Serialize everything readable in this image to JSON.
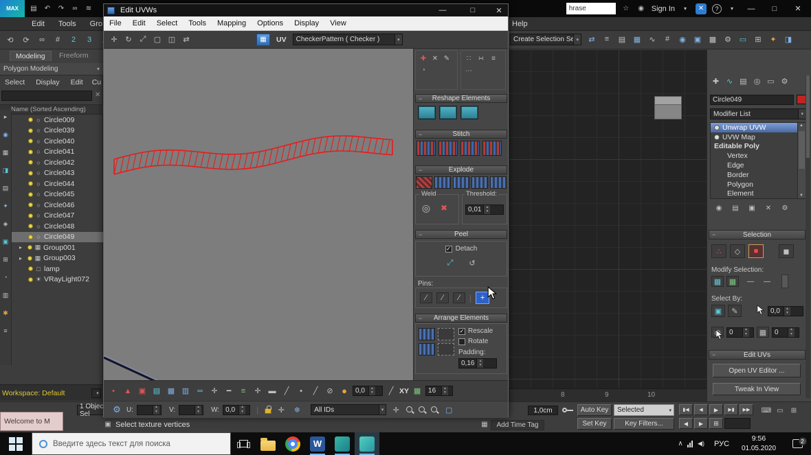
{
  "icons": {
    "check": "✓",
    "dropdown": "▾",
    "up": "▲",
    "down": "▼"
  },
  "titlebar": {
    "logo": "MAX",
    "search_value": "hrase",
    "signin": "Sign In",
    "min": "—",
    "max": "□",
    "close": "✕",
    "question": "?",
    "star": "☆",
    "user_icon": "◉",
    "x_icon": "✕",
    "dd": "▾"
  },
  "quick_icons": [
    "▤",
    "↶",
    "↷",
    "∞",
    "≋"
  ],
  "menubar": {
    "items": [
      "Edit",
      "Tools",
      "Gro"
    ],
    "help": "Help"
  },
  "toolbar": {
    "left_icons": [
      "⟲",
      "⟳",
      "∞",
      "#",
      "2",
      "3",
      "∠",
      "%"
    ],
    "create_selection": "Create Selection Se",
    "right_icons": [
      "⇄",
      "≡",
      "▤",
      "▦",
      "∿",
      "#",
      "◉",
      "▣",
      "▩",
      "⚙",
      "▭",
      "⊞",
      "✦",
      "◨"
    ]
  },
  "ribbon": {
    "tabs": [
      "Modeling",
      "Freeform"
    ],
    "subtitle": "Polygon Modeling",
    "dd": "▾"
  },
  "explorer": {
    "menus": [
      "Select",
      "Display",
      "Edit",
      "Cu"
    ],
    "clear": "✕",
    "header": "Name (Sorted Ascending)",
    "expander": "▸",
    "items": [
      {
        "label": "Circle009",
        "icon": "○"
      },
      {
        "label": "Circle039",
        "icon": "○"
      },
      {
        "label": "Circle040",
        "icon": "○"
      },
      {
        "label": "Circle041",
        "icon": "○"
      },
      {
        "label": "Circle042",
        "icon": "○"
      },
      {
        "label": "Circle043",
        "icon": "○"
      },
      {
        "label": "Circle044",
        "icon": "○"
      },
      {
        "label": "Circle045",
        "icon": "○"
      },
      {
        "label": "Circle046",
        "icon": "○"
      },
      {
        "label": "Circle047",
        "icon": "○"
      },
      {
        "label": "Circle048",
        "icon": "○"
      },
      {
        "label": "Circle049",
        "icon": "○"
      },
      {
        "label": "Group001",
        "icon": "▦"
      },
      {
        "label": "Group003",
        "icon": "▦"
      },
      {
        "label": "lamp",
        "icon": "□"
      },
      {
        "label": "VRayLight072",
        "icon": "☀"
      }
    ],
    "filter_icons": [
      "▸",
      "◉",
      "▦",
      "◨",
      "▤",
      "✦",
      "◈",
      "▣",
      "⊞",
      "◔",
      "▥",
      "✱",
      "≡"
    ],
    "workspace": "Workspace: Default"
  },
  "welcome": {
    "title": "Welcome to M"
  },
  "uvw": {
    "title": "Edit UVWs",
    "menus": [
      "File",
      "Edit",
      "Select",
      "Tools",
      "Mapping",
      "Options",
      "Display",
      "View"
    ],
    "toolbar_icons": [
      "✛",
      "↻",
      "⤢",
      "▢",
      "◫",
      "⇄"
    ],
    "uv_label": "UV",
    "pattern": "CheckerPattern  ( Checker )",
    "panel": {
      "top_icons_a": [
        "✚",
        "✕",
        "✎",
        "◔"
      ],
      "top_icons_b": [
        "∷",
        "∺",
        "≡",
        "⋯"
      ],
      "reshape": "Reshape Elements",
      "stitch": "Stitch",
      "explode": "Explode",
      "weld": "Weld",
      "weld_icons": [
        "◎",
        "✖"
      ],
      "threshold_label": "Threshold:",
      "threshold_value": "0,01",
      "peel": "Peel",
      "detach": "Detach",
      "peel_icons": [
        "⤢",
        "↺"
      ],
      "pins_label": "Pins:",
      "pin_icons": [
        "∕",
        "∕",
        "∕",
        "+"
      ],
      "arrange": "Arrange Elements",
      "rescale": "Rescale",
      "rotate": "Rotate",
      "padding_label": "Padding:",
      "padding_value": "0,16"
    },
    "bottom_icons": [
      "•",
      "▲",
      "▣",
      "▤",
      "▦",
      "▥",
      "═",
      "✛",
      "━",
      "≡",
      "✛",
      "▬",
      "╱",
      "•",
      "╱",
      "⊘",
      "●"
    ],
    "bottom": {
      "coord": "0,0",
      "slash": "╱",
      "axis": "XY",
      "grid_icon": "▦",
      "grid_value": "16",
      "u": "U:",
      "v": "V:",
      "w": "W:",
      "u_value": "",
      "v_value": "",
      "w_value": "0,0",
      "divider": "|",
      "hand": "✛",
      "snow": "❄",
      "ids": "All IDs",
      "gear": "⚙"
    },
    "status_icon": "▣"
  },
  "viewport": {
    "timeline_ticks": [
      "8",
      "9",
      "10"
    ]
  },
  "cmd": {
    "tab_icons": [
      "✚",
      "∿",
      "▤",
      "◎",
      "▭",
      "⚙"
    ],
    "object_name": "Circle049",
    "modifier_list": "Modifier List",
    "stack": [
      "Unwrap UVW",
      "UVW Map",
      "Editable Poly",
      "Vertex",
      "Edge",
      "Border",
      "Polygon",
      "Element"
    ],
    "stack_icons": [
      "◉",
      "▤",
      "▣",
      "✕",
      "⚙"
    ],
    "selection": "Selection",
    "sel_icons": [
      "∴",
      "◇",
      "■",
      "◼"
    ],
    "modify_selection": "Modify Selection:",
    "mod_icons": [
      "▦",
      "▦"
    ],
    "dash": "—",
    "select_by": "Select By:",
    "sb_icon1": "▣",
    "sb_icon2": "✎",
    "sb_icon3": "◉",
    "sb_icon4": "▦",
    "v1": "0,0",
    "v2": "0",
    "v3": "0",
    "edit_uvs": "Edit UVs",
    "open_btn": "Open UV Editor ...",
    "tweak_btn": "Tweak In View"
  },
  "status": {
    "selection": "1 Object Sel",
    "prompt": "Select texture vertices",
    "add_time_tag": "Add Time Tag",
    "grid": "1,0cm",
    "auto_key": "Auto Key",
    "selected": "Selected",
    "set_key": "Set Key",
    "key_filters": "Key Filters...",
    "play_icons": [
      "▮◀",
      "◀",
      "▶",
      "▶▮",
      "▶▶"
    ],
    "nav_icons": [
      "◀",
      "▶",
      "⊞"
    ],
    "misc_icons": [
      "⌨",
      "▭",
      "⊞"
    ]
  },
  "taskbar": {
    "search": "Введите здесь текст для поиска",
    "word": "W",
    "lang": "РУС",
    "time": "9:56",
    "date": "01.05.2020",
    "badge": "2",
    "chevron": "∧",
    "speaker": "◀)"
  }
}
